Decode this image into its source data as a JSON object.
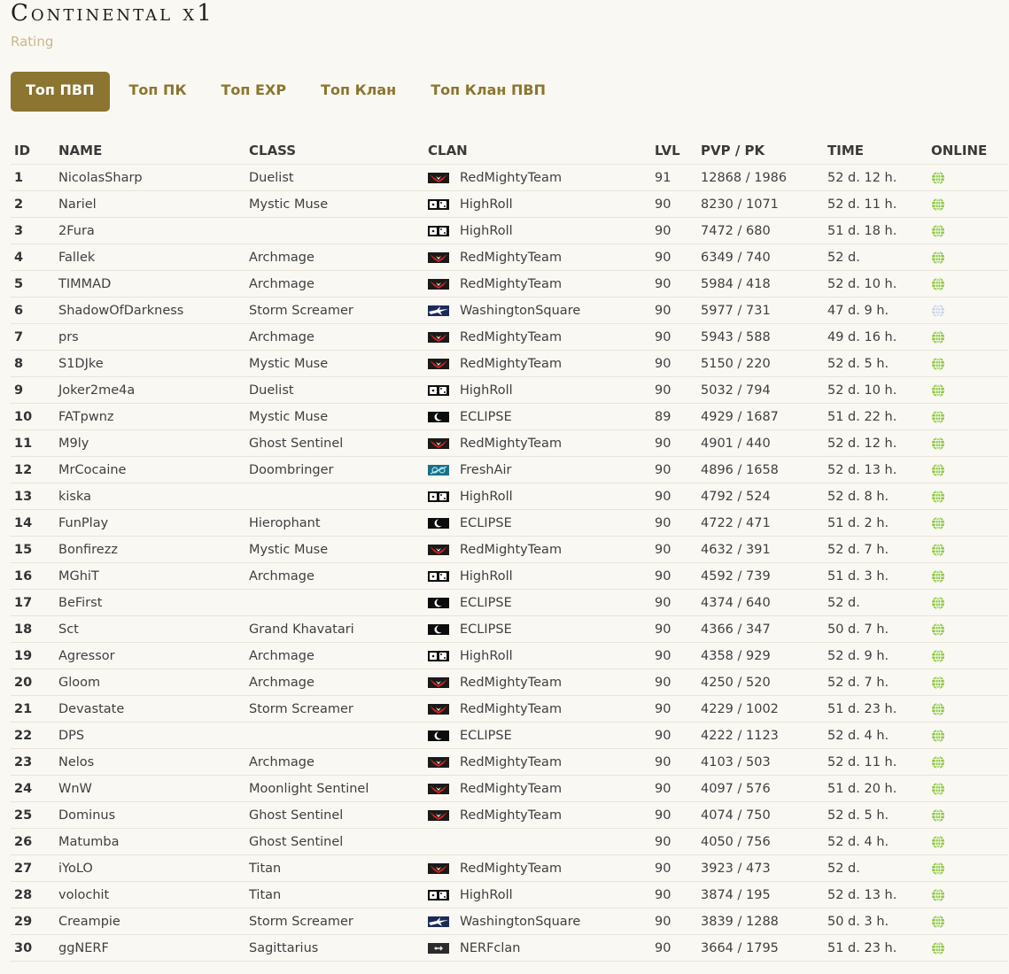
{
  "header": {
    "title": "Continental x1",
    "subtitle": "Rating"
  },
  "tabs": [
    {
      "label": "Топ ПВП",
      "active": true
    },
    {
      "label": "Топ ПК",
      "active": false
    },
    {
      "label": "Топ EXP",
      "active": false
    },
    {
      "label": "Топ Клан",
      "active": false
    },
    {
      "label": "Топ Клан ПВП",
      "active": false
    }
  ],
  "table": {
    "columns": [
      "ID",
      "NAME",
      "CLASS",
      "CLAN",
      "LVL",
      "PVP / PK",
      "TIME",
      "ONLINE"
    ],
    "rows": [
      {
        "id": "1",
        "name": "NicolasSharp",
        "class": "Duelist",
        "clan": "RedMightyTeam",
        "lvl": "91",
        "pvp_pk": "12868 / 1986",
        "time": "52 d. 12 h.",
        "online": true
      },
      {
        "id": "2",
        "name": "Nariel",
        "class": "Mystic Muse",
        "clan": "HighRoll",
        "lvl": "90",
        "pvp_pk": "8230 / 1071",
        "time": "52 d. 11 h.",
        "online": true
      },
      {
        "id": "3",
        "name": "2Fura",
        "class": "",
        "clan": "HighRoll",
        "lvl": "90",
        "pvp_pk": "7472 / 680",
        "time": "51 d. 18 h.",
        "online": true
      },
      {
        "id": "4",
        "name": "Fallek",
        "class": "Archmage",
        "clan": "RedMightyTeam",
        "lvl": "90",
        "pvp_pk": "6349 / 740",
        "time": "52 d.",
        "online": true
      },
      {
        "id": "5",
        "name": "TIMMAD",
        "class": "Archmage",
        "clan": "RedMightyTeam",
        "lvl": "90",
        "pvp_pk": "5984 / 418",
        "time": "52 d. 10 h.",
        "online": true
      },
      {
        "id": "6",
        "name": "ShadowOfDarkness",
        "class": "Storm Screamer",
        "clan": "WashingtonSquare",
        "lvl": "90",
        "pvp_pk": "5977 / 731",
        "time": "47 d. 9 h.",
        "online": false
      },
      {
        "id": "7",
        "name": "prs",
        "class": "Archmage",
        "clan": "RedMightyTeam",
        "lvl": "90",
        "pvp_pk": "5943 / 588",
        "time": "49 d. 16 h.",
        "online": true
      },
      {
        "id": "8",
        "name": "S1DJke",
        "class": "Mystic Muse",
        "clan": "RedMightyTeam",
        "lvl": "90",
        "pvp_pk": "5150 / 220",
        "time": "52 d. 5 h.",
        "online": true
      },
      {
        "id": "9",
        "name": "Joker2me4a",
        "class": "Duelist",
        "clan": "HighRoll",
        "lvl": "90",
        "pvp_pk": "5032 / 794",
        "time": "52 d. 10 h.",
        "online": true
      },
      {
        "id": "10",
        "name": "FATpwnz",
        "class": "Mystic Muse",
        "clan": "ECLIPSE",
        "lvl": "89",
        "pvp_pk": "4929 / 1687",
        "time": "51 d. 22 h.",
        "online": true
      },
      {
        "id": "11",
        "name": "M9ly",
        "class": "Ghost Sentinel",
        "clan": "RedMightyTeam",
        "lvl": "90",
        "pvp_pk": "4901 / 440",
        "time": "52 d. 12 h.",
        "online": true
      },
      {
        "id": "12",
        "name": "MrCocaine",
        "class": "Doombringer",
        "clan": "FreshAir",
        "lvl": "90",
        "pvp_pk": "4896 / 1658",
        "time": "52 d. 13 h.",
        "online": true
      },
      {
        "id": "13",
        "name": "kiska",
        "class": "",
        "clan": "HighRoll",
        "lvl": "90",
        "pvp_pk": "4792 / 524",
        "time": "52 d. 8 h.",
        "online": true
      },
      {
        "id": "14",
        "name": "FunPlay",
        "class": "Hierophant",
        "clan": "ECLIPSE",
        "lvl": "90",
        "pvp_pk": "4722 / 471",
        "time": "51 d. 2 h.",
        "online": true
      },
      {
        "id": "15",
        "name": "Bonfirezz",
        "class": "Mystic Muse",
        "clan": "RedMightyTeam",
        "lvl": "90",
        "pvp_pk": "4632 / 391",
        "time": "52 d. 7 h.",
        "online": true
      },
      {
        "id": "16",
        "name": "MGhiT",
        "class": "Archmage",
        "clan": "HighRoll",
        "lvl": "90",
        "pvp_pk": "4592 / 739",
        "time": "51 d. 3 h.",
        "online": true
      },
      {
        "id": "17",
        "name": "BeFirst",
        "class": "",
        "clan": "ECLIPSE",
        "lvl": "90",
        "pvp_pk": "4374 / 640",
        "time": "52 d.",
        "online": true
      },
      {
        "id": "18",
        "name": "Sct",
        "class": "Grand Khavatari",
        "clan": "ECLIPSE",
        "lvl": "90",
        "pvp_pk": "4366 / 347",
        "time": "50 d. 7 h.",
        "online": true
      },
      {
        "id": "19",
        "name": "Agressor",
        "class": "Archmage",
        "clan": "HighRoll",
        "lvl": "90",
        "pvp_pk": "4358 / 929",
        "time": "52 d. 9 h.",
        "online": true
      },
      {
        "id": "20",
        "name": "Gloom",
        "class": "Archmage",
        "clan": "RedMightyTeam",
        "lvl": "90",
        "pvp_pk": "4250 / 520",
        "time": "52 d. 7 h.",
        "online": true
      },
      {
        "id": "21",
        "name": "Devastate",
        "class": "Storm Screamer",
        "clan": "RedMightyTeam",
        "lvl": "90",
        "pvp_pk": "4229 / 1002",
        "time": "51 d. 23 h.",
        "online": true
      },
      {
        "id": "22",
        "name": "DPS",
        "class": "",
        "clan": "ECLIPSE",
        "lvl": "90",
        "pvp_pk": "4222 / 1123",
        "time": "52 d. 4 h.",
        "online": true
      },
      {
        "id": "23",
        "name": "Nelos",
        "class": "Archmage",
        "clan": "RedMightyTeam",
        "lvl": "90",
        "pvp_pk": "4103 / 503",
        "time": "52 d. 11 h.",
        "online": true
      },
      {
        "id": "24",
        "name": "WnW",
        "class": "Moonlight Sentinel",
        "clan": "RedMightyTeam",
        "lvl": "90",
        "pvp_pk": "4097 / 576",
        "time": "51 d. 20 h.",
        "online": true
      },
      {
        "id": "25",
        "name": "Dominus",
        "class": "Ghost Sentinel",
        "clan": "RedMightyTeam",
        "lvl": "90",
        "pvp_pk": "4074 / 750",
        "time": "52 d. 5 h.",
        "online": true
      },
      {
        "id": "26",
        "name": "Matumba",
        "class": "Ghost Sentinel",
        "clan": "",
        "lvl": "90",
        "pvp_pk": "4050 / 756",
        "time": "52 d. 4 h.",
        "online": true
      },
      {
        "id": "27",
        "name": "iYoLO",
        "class": "Titan",
        "clan": "RedMightyTeam",
        "lvl": "90",
        "pvp_pk": "3923 / 473",
        "time": "52 d.",
        "online": true
      },
      {
        "id": "28",
        "name": "volochit",
        "class": "Titan",
        "clan": "HighRoll",
        "lvl": "90",
        "pvp_pk": "3874 / 195",
        "time": "52 d. 13 h.",
        "online": true
      },
      {
        "id": "29",
        "name": "Creampie",
        "class": "Storm Screamer",
        "clan": "WashingtonSquare",
        "lvl": "90",
        "pvp_pk": "3839 / 1288",
        "time": "50 d. 3 h.",
        "online": true
      },
      {
        "id": "30",
        "name": "ggNERF",
        "class": "Sagittarius",
        "clan": "NERFclan",
        "lvl": "90",
        "pvp_pk": "3664 / 1795",
        "time": "51 d. 23 h.",
        "online": true
      }
    ]
  },
  "colors": {
    "accent": "#8b7530",
    "tab_text": "#8a7630",
    "subtitle": "#c7b98c",
    "online": "#8cc63f",
    "offline": "#c9d3e0"
  },
  "icons": {
    "online": "globe-icon",
    "clan_crest": "clan-crest-icon"
  }
}
